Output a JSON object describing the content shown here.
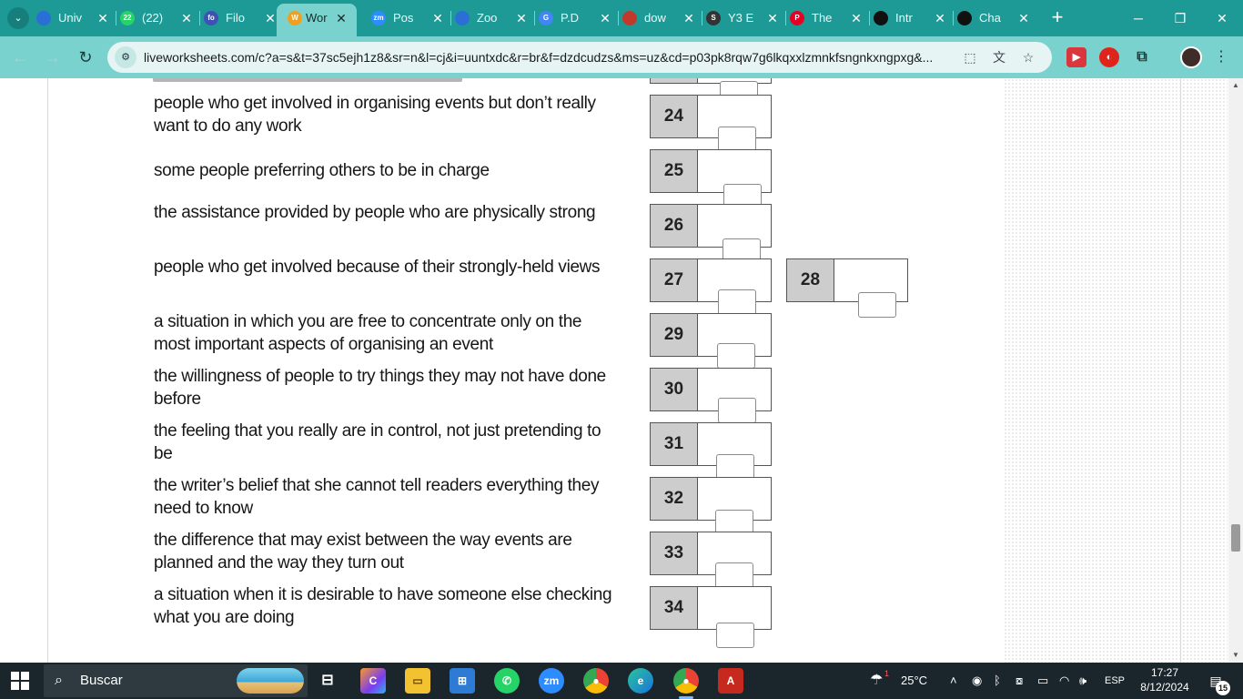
{
  "browser": {
    "tabs": [
      {
        "title": "Univ",
        "icon": "edge-tab-icon",
        "badge": "",
        "color": "#2b6fd6"
      },
      {
        "title": "(22)",
        "icon": "whatsapp-tab-icon",
        "badge": "22",
        "color": "#25d366"
      },
      {
        "title": "Filo",
        "icon": "filo-tab-icon",
        "badge": "fo",
        "color": "#3f51b5"
      },
      {
        "title": "Wor",
        "icon": "liveworksheets-tab-icon",
        "badge": "W",
        "color": "#f0a020"
      },
      {
        "title": "Pos",
        "icon": "zoom-tab-icon",
        "badge": "zm",
        "color": "#2d8cff"
      },
      {
        "title": "Zoo",
        "icon": "edge-tab-icon",
        "badge": "",
        "color": "#2b6fd6"
      },
      {
        "title": "P.D",
        "icon": "google-tab-icon",
        "badge": "G",
        "color": "#4285f4"
      },
      {
        "title": "dow",
        "icon": "download-tab-icon",
        "badge": "",
        "color": "#c0392b"
      },
      {
        "title": "Y3 E",
        "icon": "s-tab-icon",
        "badge": "S",
        "color": "#333333"
      },
      {
        "title": "The",
        "icon": "pinterest-tab-icon",
        "badge": "P",
        "color": "#e60023"
      },
      {
        "title": "Intr",
        "icon": "chatgpt-tab-icon",
        "badge": "",
        "color": "#111111"
      },
      {
        "title": "Cha",
        "icon": "chatgpt-tab-icon",
        "badge": "",
        "color": "#111111"
      }
    ],
    "url": "liveworksheets.com/c?a=s&t=37sc5ejh1z8&sr=n&l=cj&i=uuntxdc&r=br&f=dzdcudzs&ms=uz&cd=p03pk8rqw7g6lkqxxlzmnkfsngnkxngpxg&..."
  },
  "worksheet": {
    "items": [
      {
        "num": "24",
        "text": "people who get involved in organising events but don’t really want to do any work"
      },
      {
        "num": "25",
        "text": "some people preferring others to be in charge"
      },
      {
        "num": "26",
        "text": "the assistance provided by people who are physically strong"
      },
      {
        "num": "27",
        "text": "people who get involved because of their strongly-held views"
      },
      {
        "num": "28",
        "text": ""
      },
      {
        "num": "29",
        "text": "a situation in which you are free to concentrate only on the most important aspects of organising an event"
      },
      {
        "num": "30",
        "text": "the willingness of people to try things they may not have done before"
      },
      {
        "num": "31",
        "text": "the feeling that you really are in control, not just pretending to be"
      },
      {
        "num": "32",
        "text": "the writer’s belief that she cannot tell readers everything they need to know"
      },
      {
        "num": "33",
        "text": "the difference that may exist between the way events are planned and the way they turn out"
      },
      {
        "num": "34",
        "text": "a situation when it is desirable to have someone else checking what you are doing"
      }
    ]
  },
  "taskbar": {
    "search_placeholder": "Buscar",
    "weather": "25°C",
    "language": "ESP",
    "time": "17:27",
    "date": "8/12/2024",
    "notifications": "15",
    "weather_badge": "1"
  }
}
